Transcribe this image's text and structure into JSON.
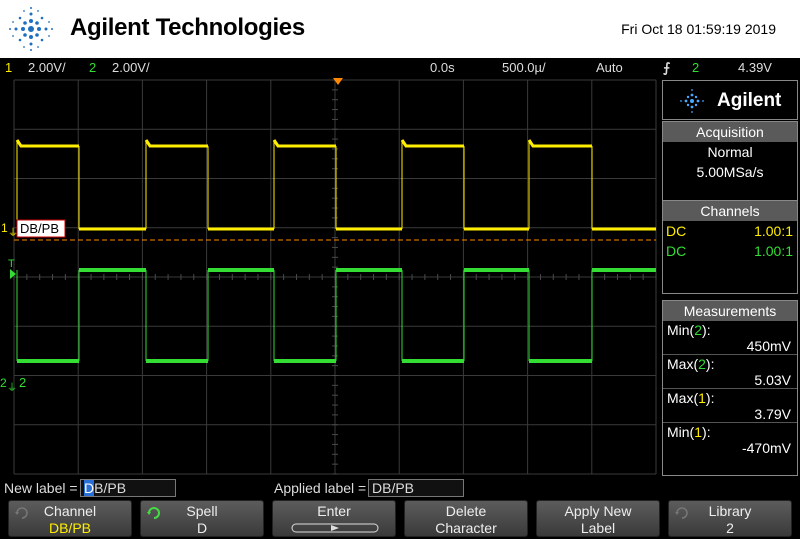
{
  "header": {
    "brand": "Agilent Technologies",
    "datetime": "Fri Oct 18 01:59:19 2019"
  },
  "status": {
    "ch1_num": "1",
    "ch1_scale": "2.00V/",
    "ch2_num": "2",
    "ch2_scale": "2.00V/",
    "time_delay": "0.0s",
    "time_scale": "500.0µ/",
    "trigger_mode": "Auto",
    "trigger_source": "2",
    "trigger_level": "4.39V"
  },
  "scope": {
    "ch1_label": "DB/PB",
    "ch1_marker": "1",
    "ch2_marker": "2",
    "ch2_label": "2",
    "trigger_marker": "T",
    "colors": {
      "ch1": "#ffee00",
      "ch2": "#33dd33",
      "grid": "#3a3a3a",
      "trigger_level": "#ff8800"
    }
  },
  "panel": {
    "brand": "Agilent",
    "acquisition": {
      "title": "Acquisition",
      "mode": "Normal",
      "rate": "5.00MSa/s"
    },
    "channels": {
      "title": "Channels",
      "rows": [
        {
          "coupling": "DC",
          "probe": "1.00:1"
        },
        {
          "coupling": "DC",
          "probe": "1.00:1"
        }
      ]
    },
    "measurements": {
      "title": "Measurements",
      "items": [
        {
          "name_pre": "Min(",
          "ch": "2",
          "name_post": "):",
          "value": "450mV",
          "color": "#33dd33"
        },
        {
          "name_pre": "Max(",
          "ch": "2",
          "name_post": "):",
          "value": "5.03V",
          "color": "#33dd33"
        },
        {
          "name_pre": "Max(",
          "ch": "1",
          "name_post": "):",
          "value": "3.79V",
          "color": "#ffee00"
        },
        {
          "name_pre": "Min(",
          "ch": "1",
          "name_post": "):",
          "value": "-470mV",
          "color": "#ffee00"
        }
      ]
    }
  },
  "labelbar": {
    "new_label_text": "New label =",
    "new_label_cursor": "D",
    "new_label_rest": "B/PB",
    "applied_label_text": "Applied label =",
    "applied_label_value": "DB/PB"
  },
  "softkeys": [
    {
      "line1": "Channel",
      "line2": "DB/PB",
      "icon": "knob-icon",
      "highlight": true
    },
    {
      "line1": "Spell",
      "line2": "D",
      "icon": "spin-knob-icon",
      "highlight": false
    },
    {
      "line1": "Enter",
      "line2": "",
      "icon": "enter-arrow-icon",
      "highlight": false
    },
    {
      "line1": "Delete",
      "line2": "Character",
      "icon": "",
      "highlight": false
    },
    {
      "line1": "Apply New",
      "line2": "Label",
      "icon": "",
      "highlight": false
    },
    {
      "line1": "Library",
      "line2": "2",
      "icon": "knob-icon",
      "highlight": false
    }
  ]
}
